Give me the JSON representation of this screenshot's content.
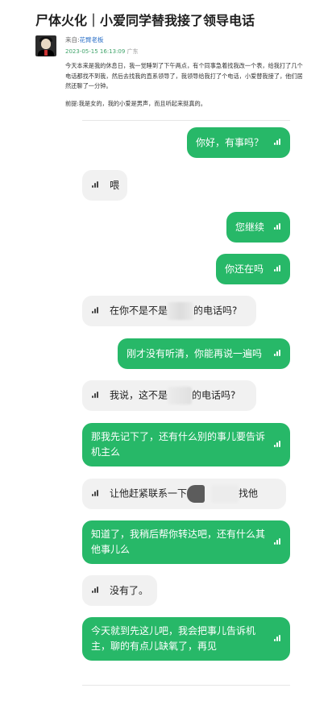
{
  "article": {
    "title": "尸体火化｜小爱同学替我接了领导电话",
    "source_label": "来自:",
    "author": "花臂老板",
    "date": "2023-05-15 16:13:09",
    "location": "广东",
    "body_p1": "今天本来是我的休息日，我一觉睡到了下午两点，有个同事急着找我改一个表，给我打了几个电话都找不到我，然后去找我的直系领导了，我领导给我打了个电话，小爱替我接了，他们居然还聊了一分钟。",
    "body_p2": "前提:我是女的，我的小爱是男声，而且听起来挺真的。"
  },
  "chat": {
    "messages": [
      {
        "side": "sent",
        "text": "你好，有事吗？"
      },
      {
        "side": "recv",
        "text": "喂"
      },
      {
        "side": "sent",
        "text": "您继续"
      },
      {
        "side": "sent",
        "text": "你还在吗"
      },
      {
        "side": "recv",
        "text_before": "在你不是不是",
        "text_after": "的电话吗?"
      },
      {
        "side": "sent",
        "text": "刚才没有听清，你能再说一遍吗"
      },
      {
        "side": "recv",
        "text_before": "我说，这不是",
        "text_after": "的电话吗?"
      },
      {
        "side": "sent",
        "text": "那我先记下了，还有什么别的事儿要告诉机主么"
      },
      {
        "side": "recv",
        "text_before": "让他赶紧联系一下",
        "text_after": "找他"
      },
      {
        "side": "sent",
        "text": "知道了，我稍后帮你转达吧，还有什么其他事儿么"
      },
      {
        "side": "recv",
        "text": "没有了。"
      },
      {
        "side": "sent",
        "text": "今天就到先这儿吧，我会把事儿告诉机主，聊的有点儿缺氧了，再见"
      }
    ]
  },
  "colors": {
    "sent_bubble": "#27b868",
    "recv_bubble": "#f1f1f1",
    "author_link": "#2a6fc7",
    "date": "#3fa46a"
  },
  "icons": {
    "voice": "voice-wave-icon",
    "avatar": "user-avatar"
  }
}
